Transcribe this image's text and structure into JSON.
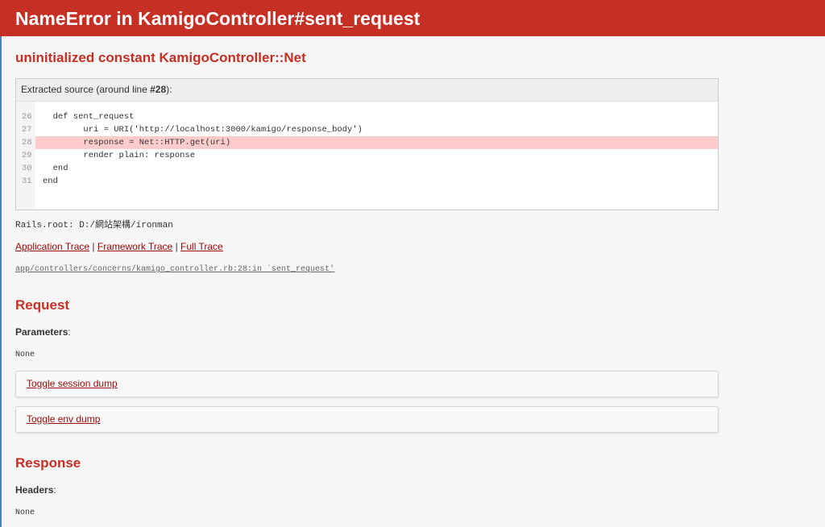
{
  "header": {
    "title": "NameError in KamigoController#sent_request"
  },
  "error_message": "uninitialized constant KamigoController::Net",
  "source": {
    "heading_prefix": "Extracted source (around line ",
    "heading_line": "#28",
    "heading_suffix": "):",
    "lines": [
      {
        "num": "26",
        "code": "  def sent_request",
        "highlight": false
      },
      {
        "num": "27",
        "code": "        uri = URI('http://localhost:3000/kamigo/response_body')",
        "highlight": false
      },
      {
        "num": "28",
        "code": "        response = Net::HTTP.get(uri)",
        "highlight": true
      },
      {
        "num": "29",
        "code": "        render plain: response",
        "highlight": false
      },
      {
        "num": "30",
        "code": "  end",
        "highlight": false
      },
      {
        "num": "31",
        "code": "end",
        "highlight": false
      }
    ]
  },
  "rails_root": "Rails.root: D:/網站架構/ironman",
  "traces": {
    "application": "Application Trace",
    "framework": "Framework Trace",
    "full": "Full Trace",
    "separator": "|",
    "first_line": "app/controllers/concerns/kamigo_controller.rb:28:in `sent_request'"
  },
  "request": {
    "heading": "Request",
    "parameters_label": "Parameters",
    "parameters_colon": ":",
    "parameters_value": "None",
    "toggle_session": "Toggle session dump",
    "toggle_env": "Toggle env dump"
  },
  "response": {
    "heading": "Response",
    "headers_label": "Headers",
    "headers_colon": ":",
    "headers_value": "None"
  },
  "colors": {
    "header_bg": "#c52f24",
    "link": "#980905",
    "highlight_row": "#ffcccc"
  }
}
